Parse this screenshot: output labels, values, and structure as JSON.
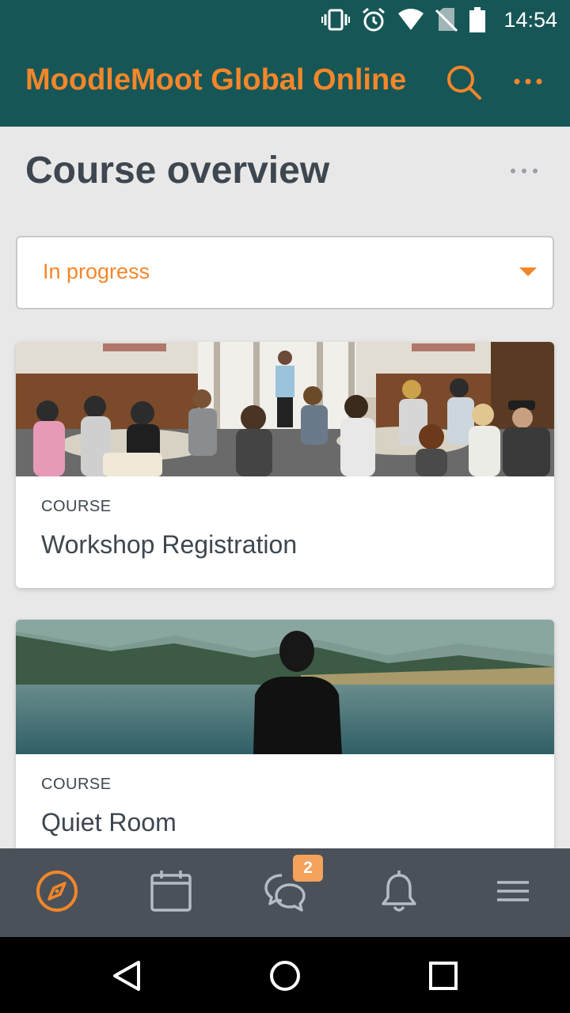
{
  "status_bar": {
    "time": "14:54",
    "icons": [
      "vibrate-icon",
      "alarm-icon",
      "wifi-icon",
      "no-sim-icon",
      "battery-icon"
    ]
  },
  "app_bar": {
    "title": "MoodleMoot Global Online",
    "icons": [
      "search-icon",
      "more-vertical-dots-icon"
    ]
  },
  "page": {
    "title": "Course overview",
    "filter": {
      "selected": "In progress"
    },
    "courses": [
      {
        "category": "COURSE",
        "title": "Workshop Registration",
        "image": "classroom-presentation"
      },
      {
        "category": "COURSE",
        "title": "Quiet Room",
        "image": "person-by-lake"
      }
    ]
  },
  "tab_bar": {
    "tabs": [
      {
        "name": "site-home",
        "icon": "compass-icon",
        "active": true
      },
      {
        "name": "calendar",
        "icon": "calendar-icon"
      },
      {
        "name": "messages",
        "icon": "chat-bubbles-icon",
        "badge": "2"
      },
      {
        "name": "notifications",
        "icon": "bell-icon"
      },
      {
        "name": "more-menu",
        "icon": "hamburger-icon"
      }
    ]
  },
  "system_nav": {
    "buttons": [
      "back-icon",
      "home-icon",
      "recents-icon"
    ]
  },
  "colors": {
    "header_bg": "#175656",
    "accent": "#f4862a",
    "text": "#3e4750",
    "tab_bar_bg": "#4a5159",
    "badge_bg": "#f4a25c"
  }
}
